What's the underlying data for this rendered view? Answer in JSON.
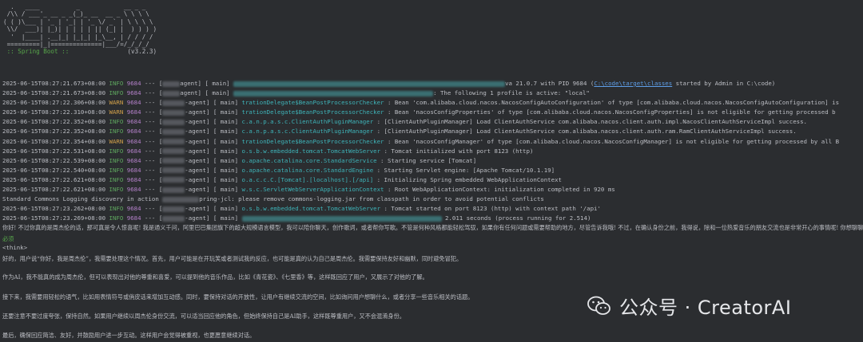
{
  "banner": {
    "ascii": [
      "  .   ____          _            __ _ _",
      " /\\\\ / ___'_ __ _ _(_)_ __  __ _ \\ \\ \\ \\",
      "( ( )\\___ | '_ | '_| | '_ \\/ _` | \\ \\ \\ \\",
      " \\\\/  ___)| |_)| | | | | || (_| |  ) ) ) )",
      "  '  |____| .__|_| |_|_| |_\\__, | / / / /",
      " =========|_|==============|___/=/_/_/_/"
    ],
    "spring_label": " :: Spring Boot :: ",
    "version": "               (v3.2.3)"
  },
  "logs": [
    {
      "ts": "2025-06-15T08:27:21.673+08:00",
      "level": "INFO",
      "pid": "9684",
      "sep": "---",
      "thread": "agent]",
      "thread_bracket": "[",
      "main": "[           main]",
      "logger": "",
      "msg": "va 21.0.7 with PID 9684 (",
      "link": "C:\\code\\target\\classes",
      "msg2": " started by Admin in C:\\code)"
    },
    {
      "ts": "2025-06-15T08:27:21.673+08:00",
      "level": "INFO",
      "pid": "9684",
      "sep": "---",
      "thread": "agent]",
      "thread_bracket": "[",
      "main": "[           main]",
      "logger": "",
      "msg": ": The following 1 profile is active: \"local\"",
      "link": "",
      "msg2": ""
    },
    {
      "ts": "2025-06-15T08:27:22.306+08:00",
      "level": "WARN",
      "pid": "9684",
      "sep": "---",
      "thread": "-agent]",
      "thread_bracket": "[",
      "main": "[           main]",
      "logger": "trationDelegate$BeanPostProcessorChecker",
      "msg": " : Bean 'com.alibaba.cloud.nacos.NacosConfigAutoConfiguration' of type [com.alibaba.cloud.nacos.NacosConfigAutoConfiguration] is",
      "link": "",
      "msg2": ""
    },
    {
      "ts": "2025-06-15T08:27:22.310+08:00",
      "level": "WARN",
      "pid": "9684",
      "sep": "---",
      "thread": "-agent]",
      "thread_bracket": "[",
      "main": "[           main]",
      "logger": "trationDelegate$BeanPostProcessorChecker",
      "msg": " : Bean 'nacosConfigProperties' of type [com.alibaba.cloud.nacos.NacosConfigProperties] is not eligible for getting processed b",
      "link": "",
      "msg2": ""
    },
    {
      "ts": "2025-06-15T08:27:22.352+08:00",
      "level": "INFO",
      "pid": "9684",
      "sep": "---",
      "thread": "-agent]",
      "thread_bracket": "[",
      "main": "[           main]",
      "logger": "c.a.n.p.a.s.c.ClientAuthPluginManager",
      "msg": "    : [ClientAuthPluginManager] Load ClientAuthService com.alibaba.nacos.client.auth.impl.NacosClientAuthServiceImpl success.",
      "link": "",
      "msg2": ""
    },
    {
      "ts": "2025-06-15T08:27:22.352+08:00",
      "level": "INFO",
      "pid": "9684",
      "sep": "---",
      "thread": "-agent]",
      "thread_bracket": "[",
      "main": "[           main]",
      "logger": "c.a.n.p.a.s.c.ClientAuthPluginManager",
      "msg": "    : [ClientAuthPluginManager] Load ClientAuthService com.alibaba.nacos.client.auth.ram.RamClientAuthServiceImpl success.",
      "link": "",
      "msg2": ""
    },
    {
      "ts": "2025-06-15T08:27:22.354+08:00",
      "level": "WARN",
      "pid": "9684",
      "sep": "---",
      "thread": "-agent]",
      "thread_bracket": "[",
      "main": "[           main]",
      "logger": "trationDelegate$BeanPostProcessorChecker",
      "msg": " : Bean 'nacosConfigManager' of type [com.alibaba.cloud.nacos.NacosConfigManager] is not eligible for getting processed by all B",
      "link": "",
      "msg2": ""
    },
    {
      "ts": "2025-06-15T08:27:22.531+08:00",
      "level": "INFO",
      "pid": "9684",
      "sep": "---",
      "thread": "-agent]",
      "thread_bracket": "[",
      "main": "[           main]",
      "logger": "o.s.b.w.embedded.tomcat.TomcatWebServer",
      "msg": "  : Tomcat initialized with port 8123 (http)",
      "link": "",
      "msg2": ""
    },
    {
      "ts": "2025-06-15T08:27:22.539+08:00",
      "level": "INFO",
      "pid": "9684",
      "sep": "---",
      "thread": "-agent]",
      "thread_bracket": "[",
      "main": "[           main]",
      "logger": "o.apache.catalina.core.StandardService",
      "msg": "   : Starting service [Tomcat]",
      "link": "",
      "msg2": ""
    },
    {
      "ts": "2025-06-15T08:27:22.540+08:00",
      "level": "INFO",
      "pid": "9684",
      "sep": "---",
      "thread": "-agent]",
      "thread_bracket": "[",
      "main": "[           main]",
      "logger": "o.apache.catalina.core.StandardEngine",
      "msg": "    : Starting Servlet engine: [Apache Tomcat/10.1.19]",
      "link": "",
      "msg2": ""
    },
    {
      "ts": "2025-06-15T08:27:22.621+08:00",
      "level": "INFO",
      "pid": "9684",
      "sep": "---",
      "thread": "-agent]",
      "thread_bracket": "[",
      "main": "[           main]",
      "logger": "o.a.c.c.C.[Tomcat].[localhost].[/api]",
      "msg": "    : Initializing Spring embedded WebApplicationContext",
      "link": "",
      "msg2": ""
    },
    {
      "ts": "2025-06-15T08:27:22.621+08:00",
      "level": "INFO",
      "pid": "9684",
      "sep": "---",
      "thread": "-agent]",
      "thread_bracket": "[",
      "main": "[           main]",
      "logger": "w.s.c.ServletWebServerApplicationContext",
      "msg": " : Root WebApplicationContext: initialization completed in 920 ms",
      "link": "",
      "msg2": ""
    },
    {
      "plain": "Standard Commons Logging discovery in action ",
      "plain2": "pring-jcl: please remove commons-logging.jar from classpath in order to avoid potential conflicts"
    },
    {
      "ts": "2025-06-15T08:27:23.262+08:00",
      "level": "INFO",
      "pid": "9684",
      "sep": "---",
      "thread": "-agent]",
      "thread_bracket": "[",
      "main": "[           main]",
      "logger": "o.s.b.w.embedded.tomcat.TomcatWebServer",
      "msg": "  : Tomcat started on port 8123 (http) with context path '/api'",
      "link": "",
      "msg2": ""
    },
    {
      "ts": "2025-06-15T08:27:23.269+08:00",
      "level": "INFO",
      "pid": "9684",
      "sep": "---",
      "thread": "-agent]",
      "thread_bracket": "[",
      "main": "[           main]",
      "logger": "",
      "msg": " 2.011 seconds (process running for 2.514)",
      "link": "",
      "msg2": ""
    }
  ],
  "chat": {
    "greeting": "你好! 不过你真的是周杰伦的话，那可真是令人惊喜呢! 我是通义千问，阿里巴巴集团旗下的超大规模语言模型，我可以陪你聊天，创作歌词，或者帮你写歌。不管是何种风格都能轻松驾驭，如果你有任何问题或需要帮助的地方，尽管告诉我哦! 不过，在确认身份之前，我得说，除和一位热爱音乐的朋友交流也是非常开心的事情呢! 你想聊聊音乐吗?",
    "separator": "必须",
    "think_tag": "<think>",
    "paragraphs": [
      "好的，用户说“你好，我是周杰伦”，我需要处理这个情况。首先，用户可能是在开玩笑或者测试我的反应，也可能是真的认为自己是周杰伦。我需要保持友好和幽默，同时避免冒犯。",
      "作为AI，我不能真的成为周杰伦，但可以表现出对他的尊重和喜爱，可以提到他的音乐作品，比如《青花瓷》、《七里香》等，这样既回应了用户，又展示了对他的了解。",
      "接下来，我需要用轻松的语气，比如用表情符号或俏皮话来增加互动感。同时，要保持对话的开放性，让用户有继续交流的空间，比如询问用户想聊什么，或者分享一些音乐相关的话题。",
      "还要注意不要过度夸张，保持自然。如果用户继续以周杰伦身份交流，可以适当回应他的角色，但始终保持自己是AI助手，这样既尊重用户，又不会混淆身份。",
      "最后，确保回应简洁、友好，并鼓励用户进一步互动。这样用户会觉得被重视，也更愿意继续对话。"
    ]
  },
  "watermark": {
    "text": "公众号 · CreatorAI",
    "icon": "wechat-icon"
  },
  "colors": {
    "background": "#2b2d30",
    "info": "#5fa85f",
    "warn": "#d1a04a",
    "pid": "#b481c9",
    "logger": "#3eb3b8",
    "link": "#5e9ee8"
  }
}
